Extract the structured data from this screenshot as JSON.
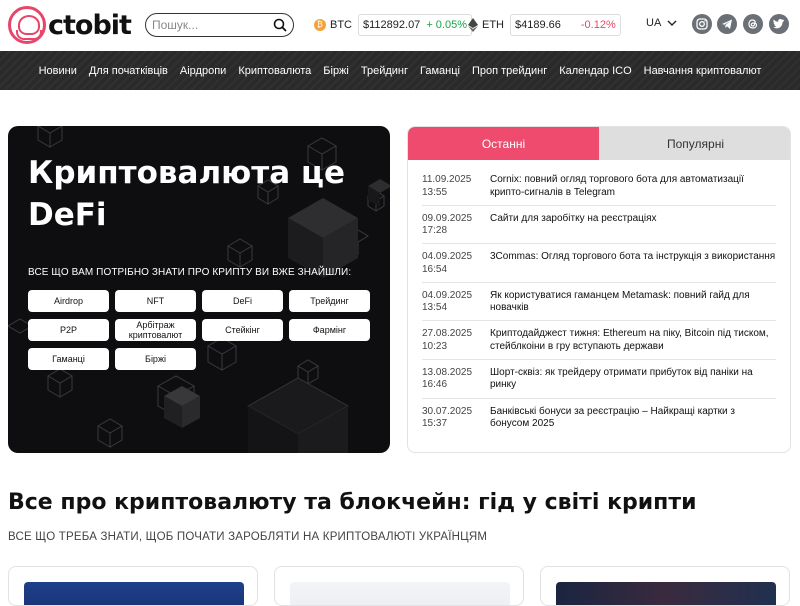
{
  "brand": {
    "logo_text": "ctobit"
  },
  "search": {
    "placeholder": "Пошук..."
  },
  "tickers": [
    {
      "symbol": "BTC",
      "price": "$112892.07",
      "change": "+ 0.05%",
      "color": "#f2a33a"
    },
    {
      "symbol": "ETH",
      "price": "$4189.66",
      "change": "-0.12%",
      "color": "#444444"
    }
  ],
  "lang": {
    "current": "UA"
  },
  "social": [
    "instagram-icon",
    "telegram-icon",
    "threads-icon",
    "twitter-icon"
  ],
  "nav": [
    "Новини",
    "Для початківців",
    "Аірдропи",
    "Криптовалюта",
    "Біржі",
    "Трейдинг",
    "Гаманці",
    "Проп трейдинг",
    "Календар ICO",
    "Навчання криптовалют"
  ],
  "hero": {
    "title": "Криптовалюта це DeFi",
    "subtitle": "ВСЕ ЩО ВАМ ПОТРІБНО ЗНАТИ ПРО КРИПТУ ВИ ВЖЕ ЗНАЙШЛИ:",
    "chips": [
      "Airdrop",
      "NFT",
      "DeFi",
      "Трейдинг",
      "P2P",
      "Арбітраж криптовалют",
      "Стейкінг",
      "Фармінг",
      "Гаманці",
      "Біржі"
    ]
  },
  "tabs": {
    "active": "Останні",
    "inactive": "Популярні"
  },
  "news": [
    {
      "date": "11.09.2025",
      "time": "13:55",
      "title": "Cornix: повний огляд торгового бота для автоматизації крипто-сигналів в Telegram"
    },
    {
      "date": "09.09.2025",
      "time": "17:28",
      "title": "Сайти для заробітку на реєстраціях"
    },
    {
      "date": "04.09.2025",
      "time": "16:54",
      "title": "3Commas: Огляд торгового бота та інструкція з використання"
    },
    {
      "date": "04.09.2025",
      "time": "13:54",
      "title": "Як користуватися гаманцем Metamask: повний гайд для новачків"
    },
    {
      "date": "27.08.2025",
      "time": "10:23",
      "title": "Криптодайджест тижня: Ethereum на піку, Bitcoin під тиском, стейблкоіни в гру вступають держави"
    },
    {
      "date": "13.08.2025",
      "time": "16:46",
      "title": "Шорт-сквіз: як трейдеру отримати прибуток від паніки на ринку"
    },
    {
      "date": "30.07.2025",
      "time": "15:37",
      "title": "Банківські бонуси за реєстрацію – Найкращі картки з бонусом 2025"
    }
  ],
  "section": {
    "title": "Все про криптовалюту та блокчейн: гід у світі крипти",
    "subtitle": "ВСЕ ЩО ТРЕБА ЗНАТИ, ЩОБ ПОЧАТИ ЗАРОБЛЯТИ НА КРИПТОВАЛЮТІ УКРАЇНЦЯМ"
  },
  "colors": {
    "accent": "#ee4b6e",
    "nav_bg": "#2a2a2a",
    "up": "#1aa34a",
    "down": "#e8456a"
  }
}
